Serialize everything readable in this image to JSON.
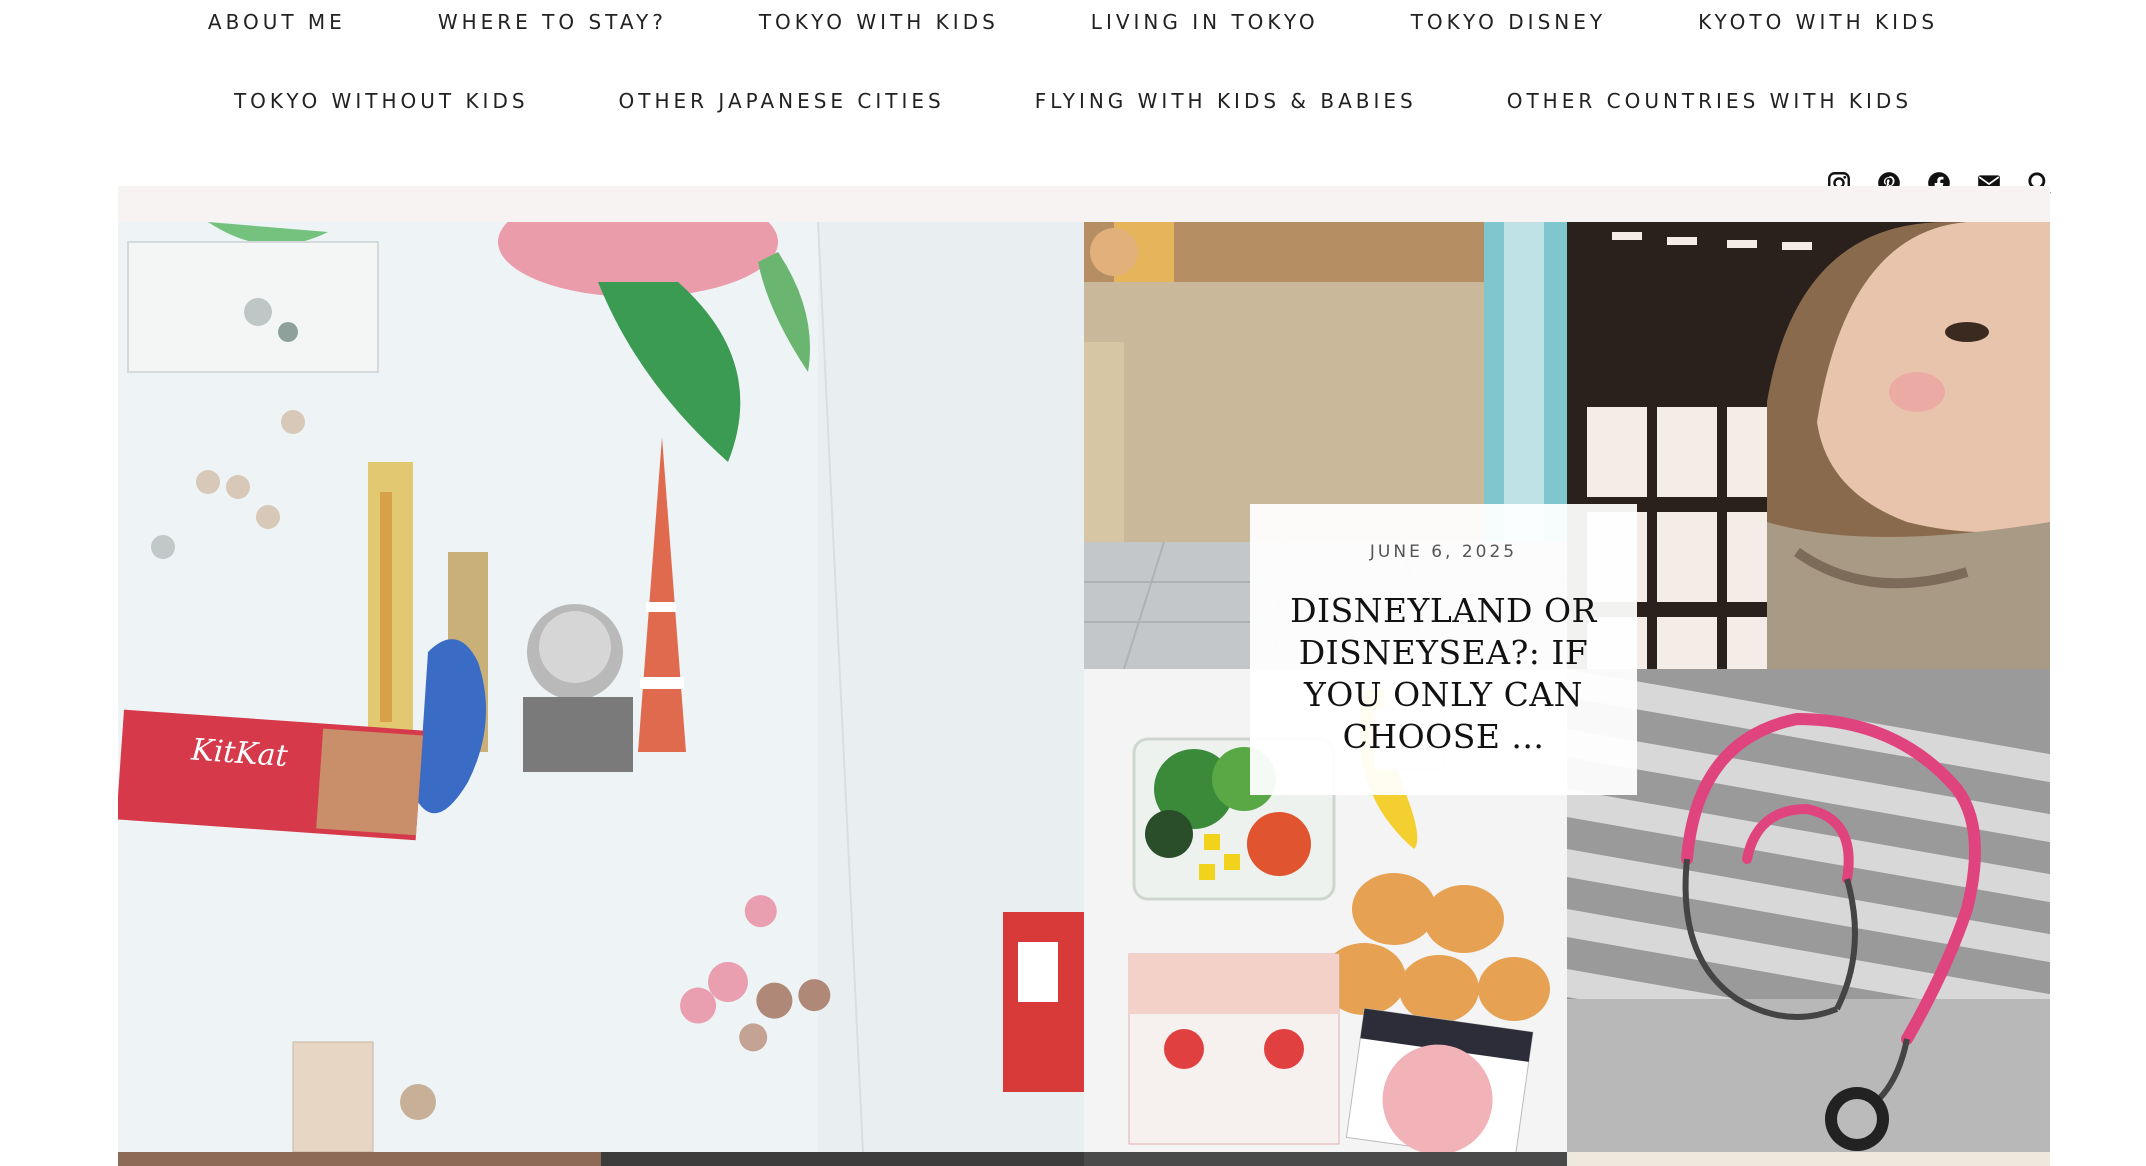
{
  "nav": {
    "row1": [
      "ABOUT ME",
      "WHERE TO STAY?",
      "TOKYO WITH KIDS",
      "LIVING IN TOKYO",
      "TOKYO DISNEY",
      "KYOTO WITH KIDS"
    ],
    "row2": [
      "TOKYO WITHOUT KIDS",
      "OTHER JAPANESE CITIES",
      "FLYING WITH KIDS & BABIES",
      "OTHER COUNTRIES WITH KIDS"
    ]
  },
  "social_icons": [
    "instagram-icon",
    "pinterest-icon",
    "facebook-icon",
    "envelope-icon",
    "search-icon"
  ],
  "featured": {
    "date": "JUNE 6, 2025",
    "title": "DISNEYLAND OR DISNEYSEA?: IF YOU ONLY CAN CHOOSE ..."
  },
  "colors": {
    "nav_text": "#222222",
    "background": "#ffffff",
    "card_bg": "#ffffff"
  }
}
